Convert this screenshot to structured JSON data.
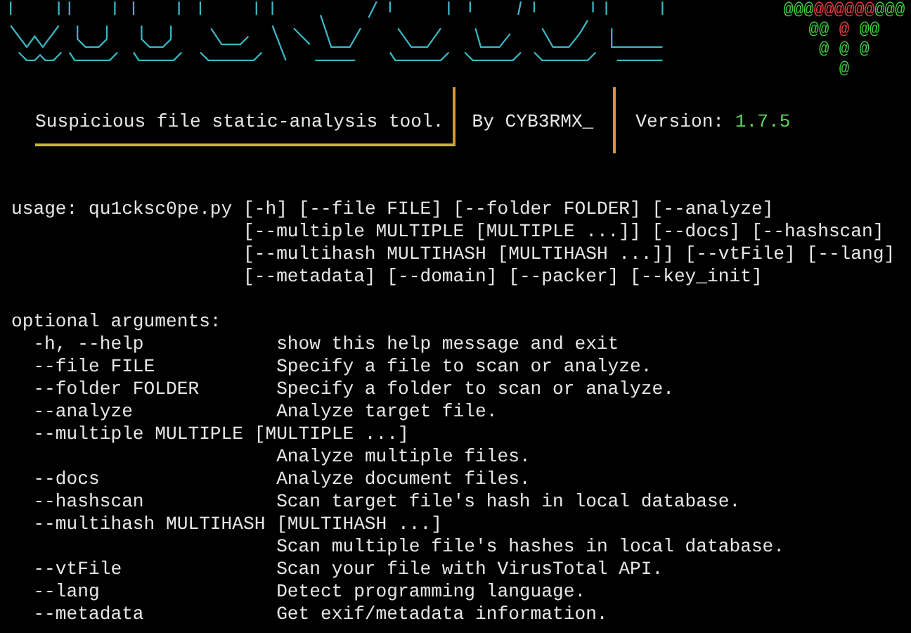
{
  "logo_tree": [
    [
      {
        "text": "@@@",
        "color": "#3ec93e"
      },
      {
        "text": "@@@@@@",
        "color": "#e04040"
      },
      {
        "text": "@@@",
        "color": "#3ec93e"
      }
    ],
    [
      {
        "text": "@@ ",
        "color": "#3ec93e"
      },
      {
        "text": "@",
        "color": "#e04040"
      },
      {
        "text": " @@",
        "color": "#3ec93e"
      }
    ],
    [
      {
        "text": "@ @ @",
        "color": "#3ec93e"
      }
    ],
    [
      {
        "text": "@",
        "color": "#3ec93e"
      }
    ]
  ],
  "banner": {
    "tagline": "Suspicious file static-analysis tool.",
    "author": "By CYB3RMX_",
    "version_label": "Version:",
    "version": "1.7.5"
  },
  "usage": {
    "prefix": "usage: qu1cksc0pe.py",
    "lines": [
      "[-h] [--file FILE] [--folder FOLDER] [--analyze]",
      "[--multiple MULTIPLE [MULTIPLE ...]] [--docs] [--hashscan]",
      "[--multihash MULTIHASH [MULTIHASH ...]] [--vtFile] [--lang]",
      "[--metadata] [--domain] [--packer] [--key_init]"
    ]
  },
  "optional_arguments": {
    "heading": "optional arguments:",
    "options": [
      {
        "flag": "-h, --help",
        "description": "show this help message and exit"
      },
      {
        "flag": "--file FILE",
        "description": "Specify a file to scan or analyze."
      },
      {
        "flag": "--folder FOLDER",
        "description": "Specify a folder to scan or analyze."
      },
      {
        "flag": "--analyze",
        "description": "Analyze target file."
      },
      {
        "flag": "--multiple MULTIPLE [MULTIPLE ...]",
        "description": "Analyze multiple files."
      },
      {
        "flag": "--docs",
        "description": "Analyze document files."
      },
      {
        "flag": "--hashscan",
        "description": "Scan target file's hash in local database."
      },
      {
        "flag": "--multihash MULTIHASH [MULTIHASH ...]",
        "description": "Scan multiple file's hashes in local database."
      },
      {
        "flag": "--vtFile",
        "description": "Scan your file with VirusTotal API."
      },
      {
        "flag": "--lang",
        "description": "Detect programming language."
      },
      {
        "flag": "--metadata",
        "description": "Get exif/metadata information."
      }
    ]
  }
}
